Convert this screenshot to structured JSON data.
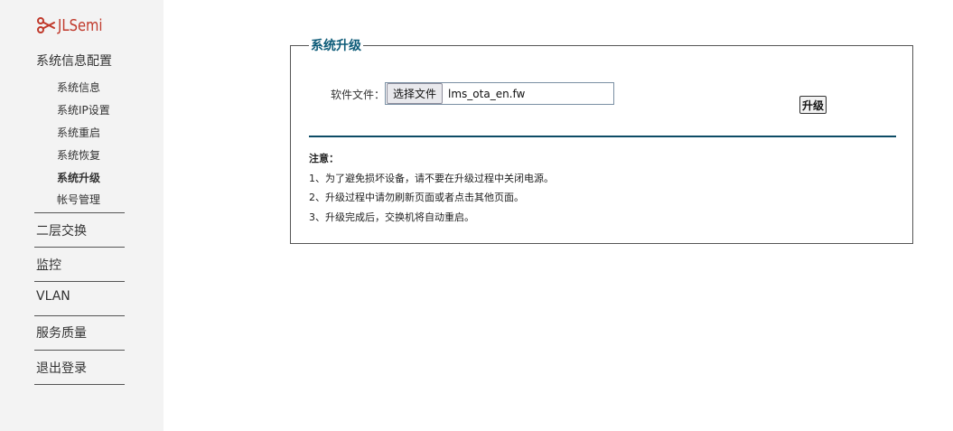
{
  "sidebar": {
    "logo_text": "JLSemi",
    "sections": [
      {
        "label": "系统信息配置"
      },
      {
        "label": "二层交换"
      },
      {
        "label": "监控"
      },
      {
        "label": "VLAN"
      },
      {
        "label": "服务质量"
      },
      {
        "label": "退出登录"
      }
    ],
    "sub_items": [
      {
        "label": "系统信息"
      },
      {
        "label": "系统IP设置"
      },
      {
        "label": "系统重启"
      },
      {
        "label": "系统恢复"
      },
      {
        "label": "系统升级",
        "active": true
      },
      {
        "label": "帐号管理"
      }
    ]
  },
  "panel": {
    "title": "系统升级",
    "file_label": "软件文件：",
    "choose_file_button": "选择文件",
    "file_name": "lms_ota_en.fw",
    "upgrade_button": "升级",
    "notice_title": "注意：",
    "notices": [
      "1、为了避免损坏设备，请不要在升级过程中关闭电源。",
      "2、升级过程中请勿刷新页面或者点击其他页面。",
      "3、升级完成后，交换机将自动重启。"
    ]
  },
  "colors": {
    "accent": "#0d5b78",
    "logo": "#c0392b",
    "sidebar_bg": "#f3f3f3"
  }
}
